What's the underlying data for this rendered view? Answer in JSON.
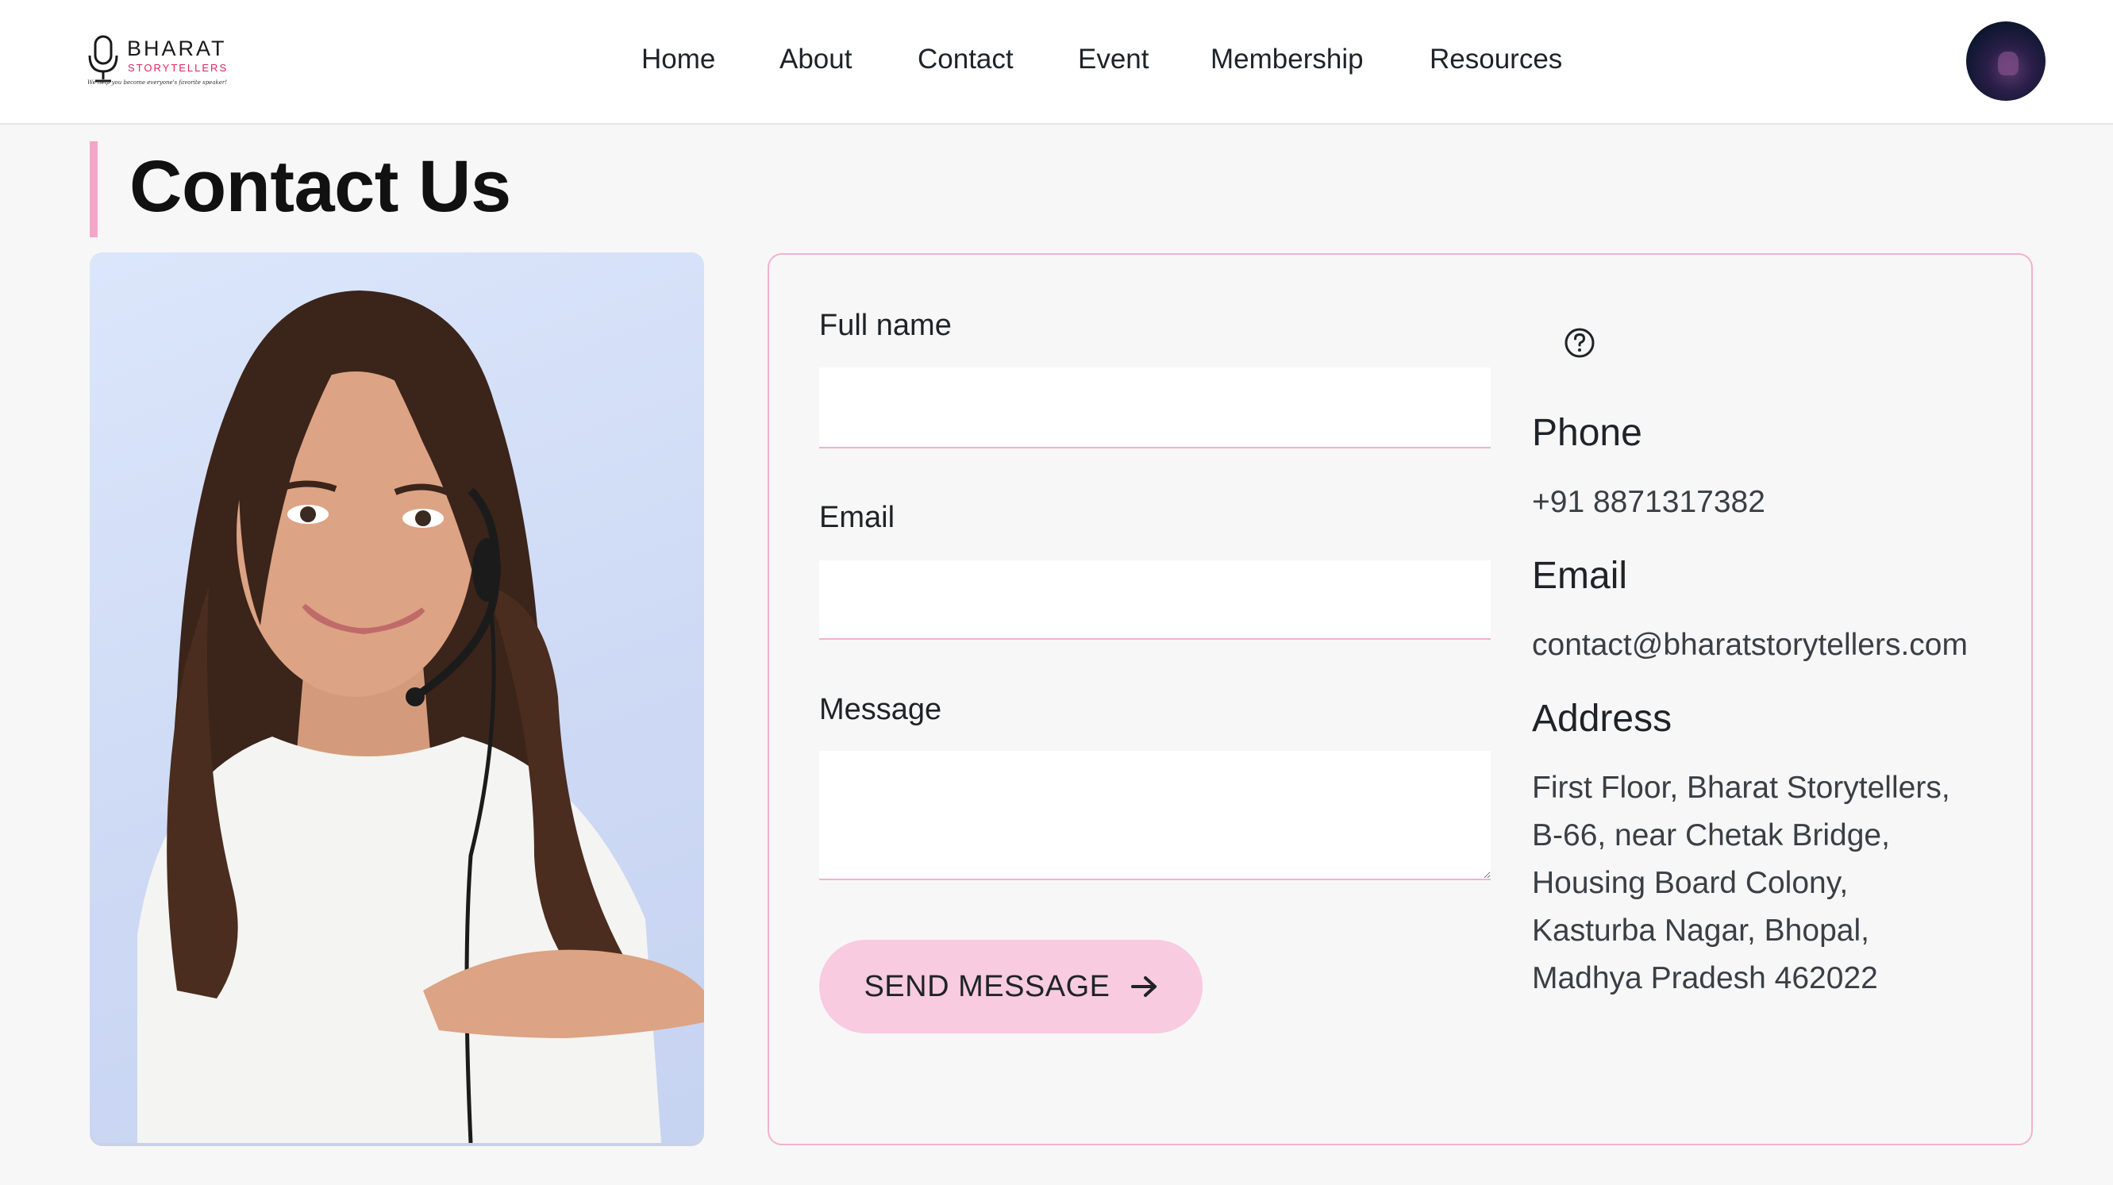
{
  "header": {
    "logo": {
      "title": "BHARAT",
      "subtitle": "STORYTELLERS",
      "tagline": "We help you become everyone's favorite speaker!",
      "icon": "microphone-icon"
    },
    "nav": [
      {
        "label": "Home"
      },
      {
        "label": "About"
      },
      {
        "label": "Contact"
      },
      {
        "label": "Event"
      },
      {
        "label": "Membership"
      },
      {
        "label": "Resources"
      }
    ],
    "avatar_icon": "user-avatar"
  },
  "page": {
    "title": "Contact Us"
  },
  "form": {
    "fullname_label": "Full name",
    "fullname_value": "",
    "email_label": "Email",
    "email_value": "",
    "message_label": "Message",
    "message_value": "",
    "send_label": "SEND MESSAGE",
    "send_icon": "arrow-right-icon"
  },
  "contact_info": {
    "help_icon": "question-circle-icon",
    "phone_heading": "Phone",
    "phone": "+91 8871317382",
    "email_heading": "Email",
    "email": "contact@bharatstorytellers.com",
    "address_heading": "Address",
    "address_lines": [
      "First Floor, Bharat Storytellers,",
      "B-66, near Chetak Bridge,",
      "Housing Board Colony,",
      "Kasturba Nagar, Bhopal,",
      "Madhya Pradesh 462022"
    ]
  },
  "colors": {
    "accent_pink": "#f4a6c8",
    "button_pink": "#f8cbe0",
    "brand_red": "#e0245e",
    "background": "#f7f7f7"
  }
}
